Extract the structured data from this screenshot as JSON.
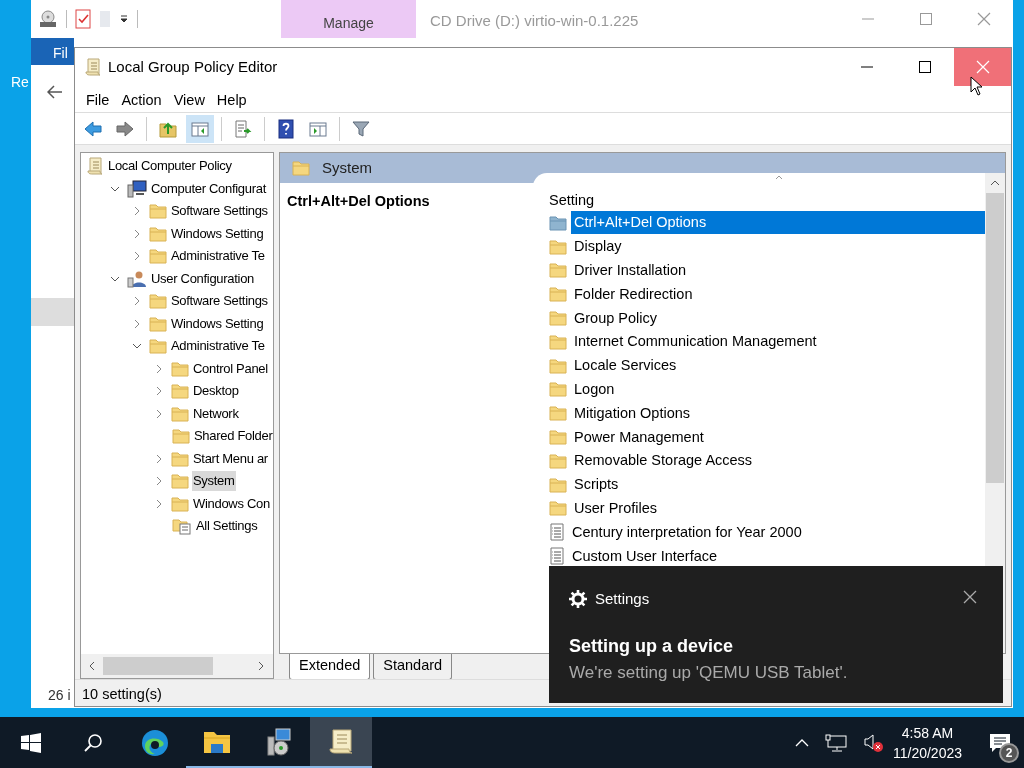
{
  "desktop_icons": [
    {
      "label": "Re"
    }
  ],
  "background_window": {
    "title": "CD Drive (D:) virtio-win-0.1.225",
    "ribbon_tab": "Manage",
    "file_tab": "Fil",
    "status": "26 i"
  },
  "window": {
    "title": "Local Group Policy Editor"
  },
  "menu": [
    "File",
    "Action",
    "View",
    "Help"
  ],
  "tree": [
    {
      "label": "Local Computer Policy",
      "kind": "policy",
      "selected": false,
      "children": [
        {
          "label": "Computer Configurat",
          "kind": "computer",
          "expanded": true,
          "selected": false,
          "children": [
            {
              "label": "Software Settings",
              "kind": "folder",
              "expanded": false,
              "selected": false
            },
            {
              "label": "Windows Setting",
              "kind": "folder",
              "expanded": false,
              "selected": false
            },
            {
              "label": "Administrative Te",
              "kind": "folder",
              "expanded": false,
              "selected": false
            }
          ]
        },
        {
          "label": "User Configuration",
          "kind": "user",
          "expanded": true,
          "selected": false,
          "children": [
            {
              "label": "Software Settings",
              "kind": "folder",
              "expanded": false,
              "selected": false
            },
            {
              "label": "Windows Setting",
              "kind": "folder",
              "expanded": false,
              "selected": false
            },
            {
              "label": "Administrative Te",
              "kind": "folder",
              "expanded": true,
              "selected": false,
              "children": [
                {
                  "label": "Control Panel",
                  "kind": "folder",
                  "expanded": false,
                  "selected": false
                },
                {
                  "label": "Desktop",
                  "kind": "folder",
                  "expanded": false,
                  "selected": false
                },
                {
                  "label": "Network",
                  "kind": "folder",
                  "expanded": false,
                  "selected": false
                },
                {
                  "label": "Shared Folder",
                  "kind": "folder",
                  "selected": false
                },
                {
                  "label": "Start Menu ar",
                  "kind": "folder",
                  "expanded": false,
                  "selected": false
                },
                {
                  "label": "System",
                  "kind": "folder",
                  "expanded": false,
                  "selected": true
                },
                {
                  "label": "Windows Con",
                  "kind": "folder",
                  "expanded": false,
                  "selected": false
                },
                {
                  "label": "All Settings",
                  "kind": "allsettings",
                  "selected": false
                }
              ]
            }
          ]
        }
      ]
    }
  ],
  "header": {
    "title": "System"
  },
  "description_title": "Ctrl+Alt+Del Options",
  "list": {
    "column": "Setting",
    "rows": [
      {
        "label": "Ctrl+Alt+Del Options",
        "kind": "folder",
        "selected": true
      },
      {
        "label": "Display",
        "kind": "folder",
        "selected": false
      },
      {
        "label": "Driver Installation",
        "kind": "folder",
        "selected": false
      },
      {
        "label": "Folder Redirection",
        "kind": "folder",
        "selected": false
      },
      {
        "label": "Group Policy",
        "kind": "folder",
        "selected": false
      },
      {
        "label": "Internet Communication Management",
        "kind": "folder",
        "selected": false
      },
      {
        "label": "Locale Services",
        "kind": "folder",
        "selected": false
      },
      {
        "label": "Logon",
        "kind": "folder",
        "selected": false
      },
      {
        "label": "Mitigation Options",
        "kind": "folder",
        "selected": false
      },
      {
        "label": "Power Management",
        "kind": "folder",
        "selected": false
      },
      {
        "label": "Removable Storage Access",
        "kind": "folder",
        "selected": false
      },
      {
        "label": "Scripts",
        "kind": "folder",
        "selected": false
      },
      {
        "label": "User Profiles",
        "kind": "folder",
        "selected": false
      },
      {
        "label": "Century interpretation for Year 2000",
        "kind": "setting",
        "selected": false
      },
      {
        "label": "Custom User Interface",
        "kind": "setting",
        "selected": false
      }
    ]
  },
  "view_tabs": [
    {
      "label": "Extended",
      "selected": true
    },
    {
      "label": "Standard",
      "selected": false
    }
  ],
  "status_bar": "10 setting(s)",
  "notification": {
    "app": "Settings",
    "title": "Setting up a device",
    "body": "We're setting up 'QEMU USB Tablet'."
  },
  "taskbar": {
    "apps": [
      {
        "kind": "edge",
        "running": false,
        "active": false
      },
      {
        "kind": "explorer",
        "running": true,
        "active": false
      },
      {
        "kind": "servermanager",
        "running": true,
        "active": false
      },
      {
        "kind": "policy",
        "running": true,
        "active": true
      }
    ],
    "time": "4:58 AM",
    "date": "11/20/2023",
    "badge": "2"
  }
}
